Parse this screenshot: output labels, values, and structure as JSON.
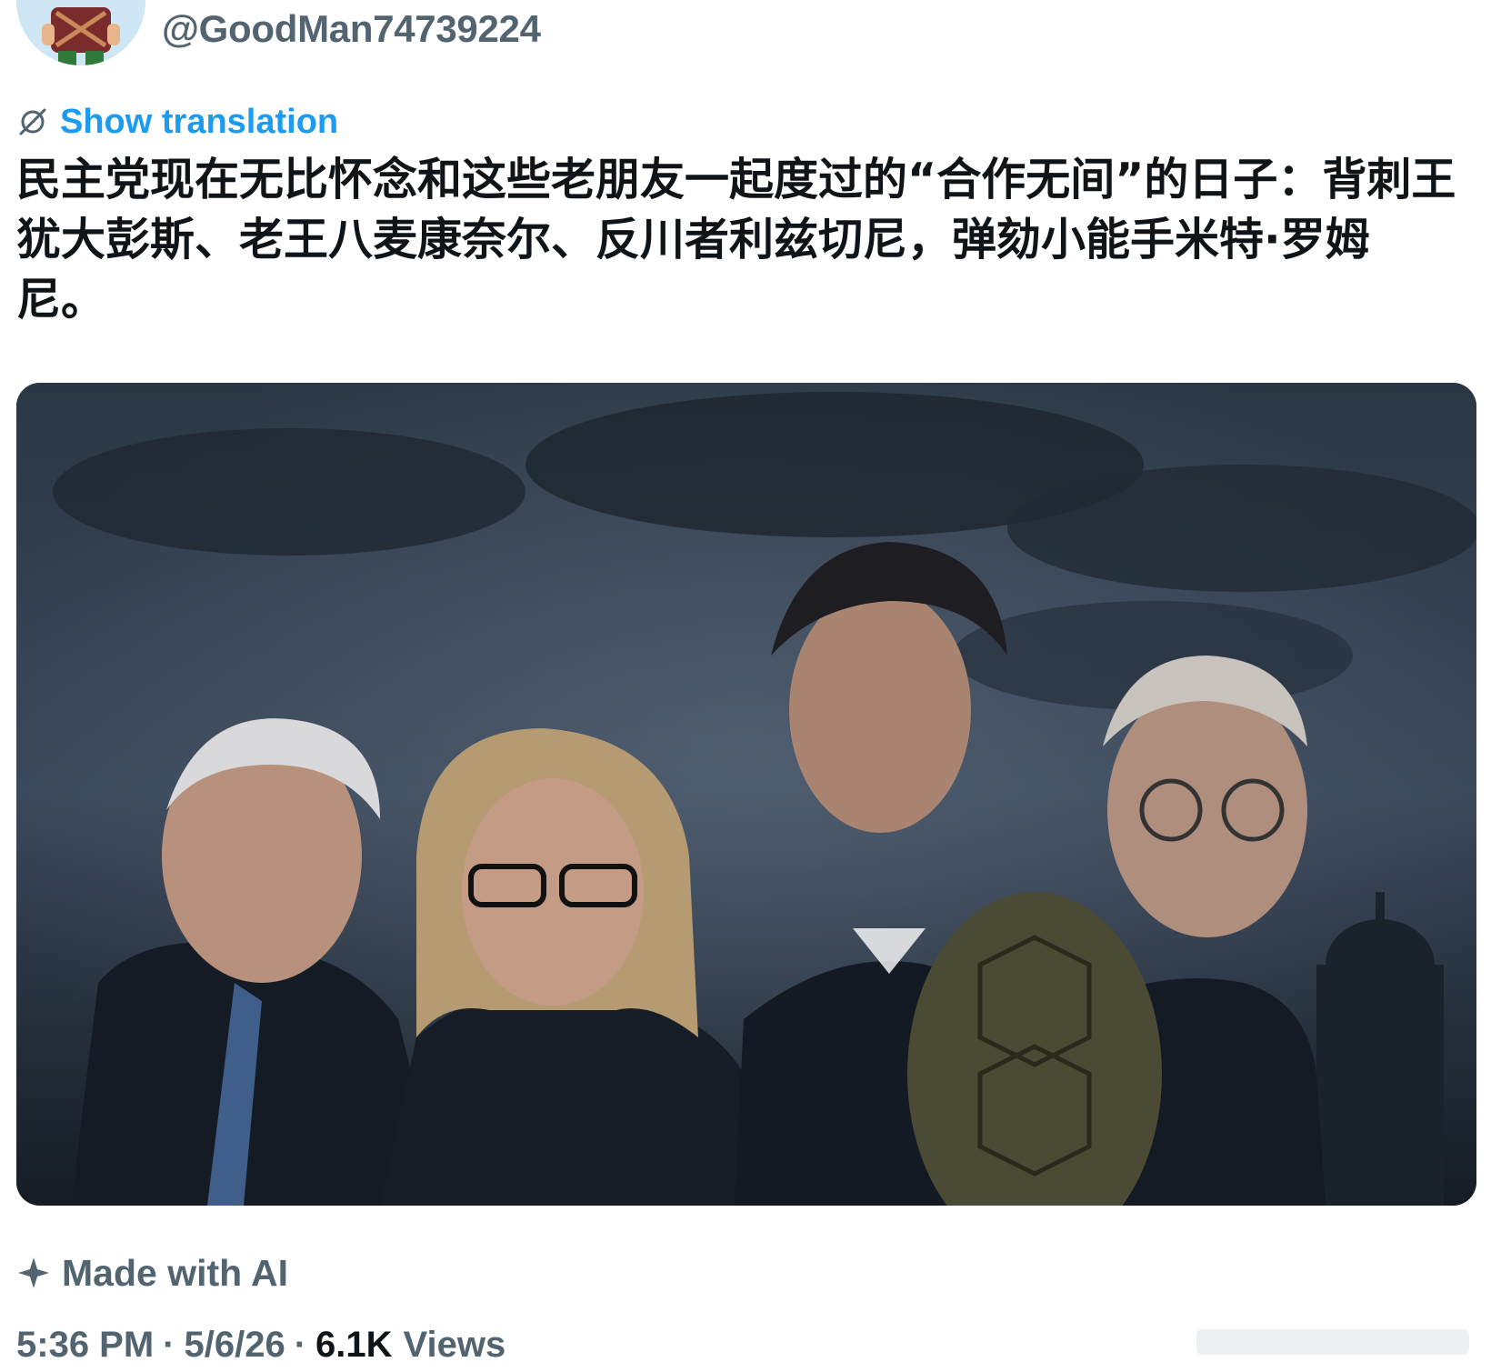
{
  "author": {
    "handle": "@GoodMan74739224",
    "avatar_icon": "cartoon-avatar-icon"
  },
  "translation": {
    "icon": "globe-slash-icon",
    "label": "Show translation"
  },
  "tweet": {
    "text": "民主党现在无比怀念和这些老朋友一起度过的“合作无间”的日子：背刺王\n犹大彭斯、老王八麦康奈尔、反川者利兹切尼，弹劾小能手米特·罗姆\n尼。"
  },
  "media": {
    "type": "image"
  },
  "ai_label": {
    "icon": "sparkle-icon",
    "label": "Made with AI"
  },
  "meta": {
    "time": "5:36 PM",
    "separator": "·",
    "date": "5/6/26",
    "views_count": "6.1K",
    "views_label": "Views"
  },
  "colors": {
    "link": "#1d9bf0",
    "secondary_text": "#536471",
    "primary_text": "#0f1419"
  }
}
